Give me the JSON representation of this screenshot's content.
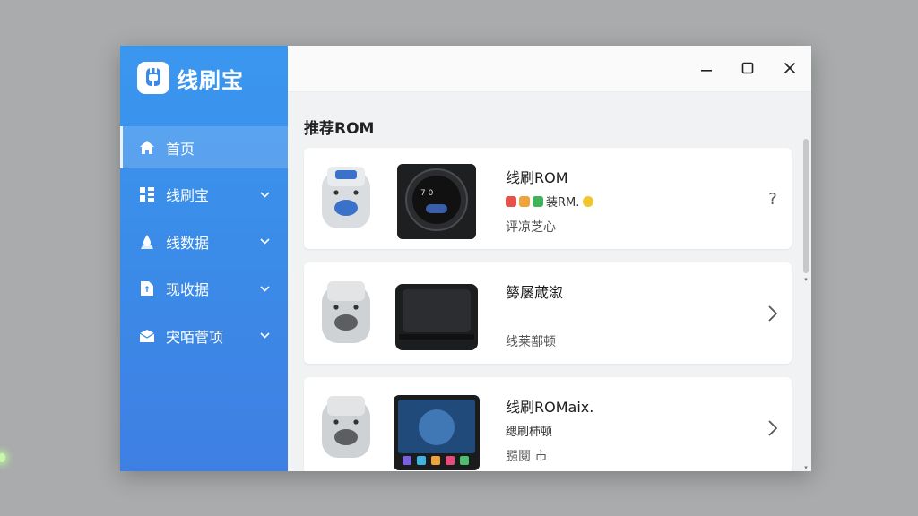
{
  "app": {
    "name": "线刷宝",
    "accent": "#3b8ae8"
  },
  "sidebar": {
    "items": [
      {
        "label": "首页",
        "icon": "home-icon",
        "active": true
      },
      {
        "label": "线刷宝",
        "icon": "grid-icon",
        "expandable": true
      },
      {
        "label": "线数据",
        "icon": "drop-icon",
        "expandable": true
      },
      {
        "label": "现收据",
        "icon": "file-icon",
        "expandable": true
      },
      {
        "label": "宊咟菅项",
        "icon": "mail-icon",
        "expandable": true
      }
    ]
  },
  "window": {
    "controls": [
      "minimize-icon",
      "maximize-icon",
      "close-icon"
    ]
  },
  "main": {
    "section_title": "推荐ROM",
    "cards": [
      {
        "title": "线刷ROM",
        "subtitle": "装RM.",
        "detail": "评凉芝心",
        "action": "?"
      },
      {
        "title": "簩屡葴溆",
        "subtitle": "",
        "detail": "线莱鄯顿",
        "action": "chevron-right-icon"
      },
      {
        "title": "线刷ROMaix.",
        "subtitle": "缌刷柿顿",
        "detail": "膙鬩 市",
        "action": "chevron-right-icon"
      }
    ]
  }
}
